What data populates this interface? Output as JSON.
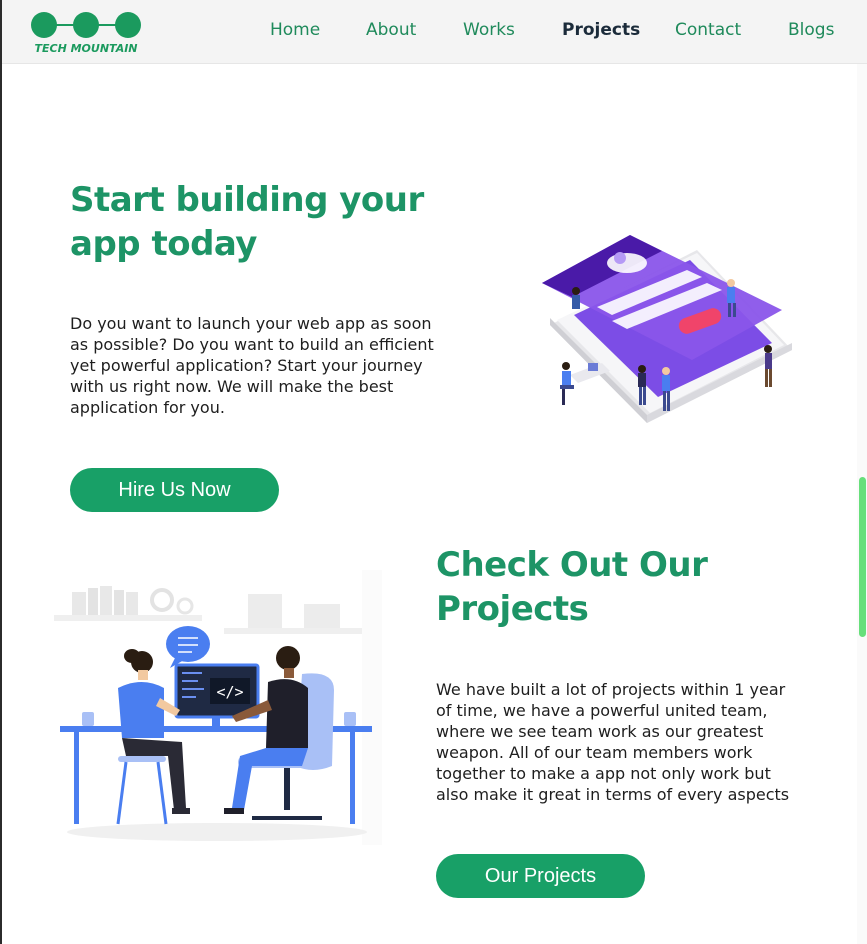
{
  "header": {
    "logo_text": "TECH MOUNTAIN",
    "nav": [
      {
        "label": "Home",
        "active": false
      },
      {
        "label": "About",
        "active": false
      },
      {
        "label": "Works",
        "active": false
      },
      {
        "label": "Projects",
        "active": true
      },
      {
        "label": "Contact",
        "active": false
      },
      {
        "label": "Blogs",
        "active": false
      }
    ]
  },
  "hero": {
    "title": "Start building your app today",
    "text": "Do you want to launch your web app as soon as possible? Do you want to build an efficient yet powerful application? Start your journey with us right now. We will make the best application for you.",
    "button_label": "Hire Us Now"
  },
  "projects": {
    "title": "Check Out Our Projects",
    "text": "We have built a lot of projects within 1 year of time, we have a powerful united team, where we see team work as our greatest weapon. All of our team members work together to make a app not only work but also make it great in terms of every aspects",
    "button_label": "Our Projects",
    "code_glyph": "</>"
  },
  "colors": {
    "brand_green": "#18a067",
    "title_green": "#1d9466",
    "nav_active": "#1b2b3a",
    "purple": "#7b3fe4",
    "blue": "#4a7ef0"
  }
}
